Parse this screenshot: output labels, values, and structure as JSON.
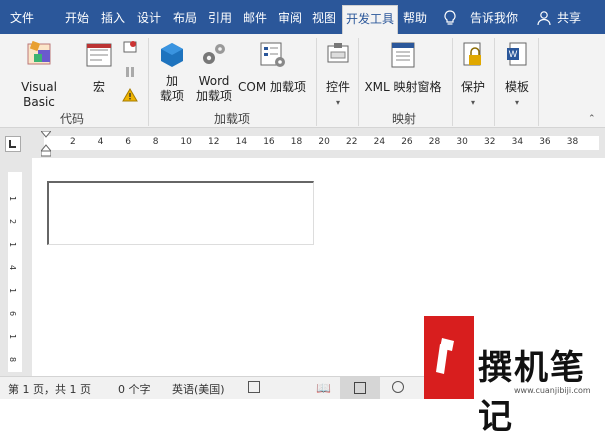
{
  "tabs": [
    "文件",
    "开始",
    "插入",
    "设计",
    "布局",
    "引用",
    "邮件",
    "审阅",
    "视图",
    "开发工具",
    "帮助"
  ],
  "active_tab": "开发工具",
  "tell_me": "告诉我你",
  "share": "共享",
  "ribbon": {
    "visual_basic": "Visual Basic",
    "macro": "宏",
    "group_code": "代码",
    "addins_1": "加",
    "addins_2": "载项",
    "word_addins_1": "Word",
    "word_addins_2": "加载项",
    "com_addins": "COM 加载项",
    "group_addins": "加载项",
    "controls": "控件",
    "xml_pane": "XML 映射窗格",
    "group_mapping": "映射",
    "protect": "保护",
    "template": "模板"
  },
  "ruler": [
    "2",
    "4",
    "6",
    "8",
    "10",
    "12",
    "14",
    "16",
    "18",
    "20",
    "22",
    "24",
    "26",
    "28",
    "30",
    "32",
    "34",
    "36",
    "38"
  ],
  "vruler": [
    "1",
    "2",
    "1",
    "4",
    "1",
    "6",
    "1",
    "8"
  ],
  "status": {
    "page": "第 1 页，共 1 页",
    "words": "0 个字",
    "lang": "英语(美国)"
  },
  "watermark": {
    "title": "撰机笔记",
    "url": "www.cuanjibiji.com"
  },
  "colors": {
    "accent": "#2b579a",
    "red": "#d81e1e"
  }
}
